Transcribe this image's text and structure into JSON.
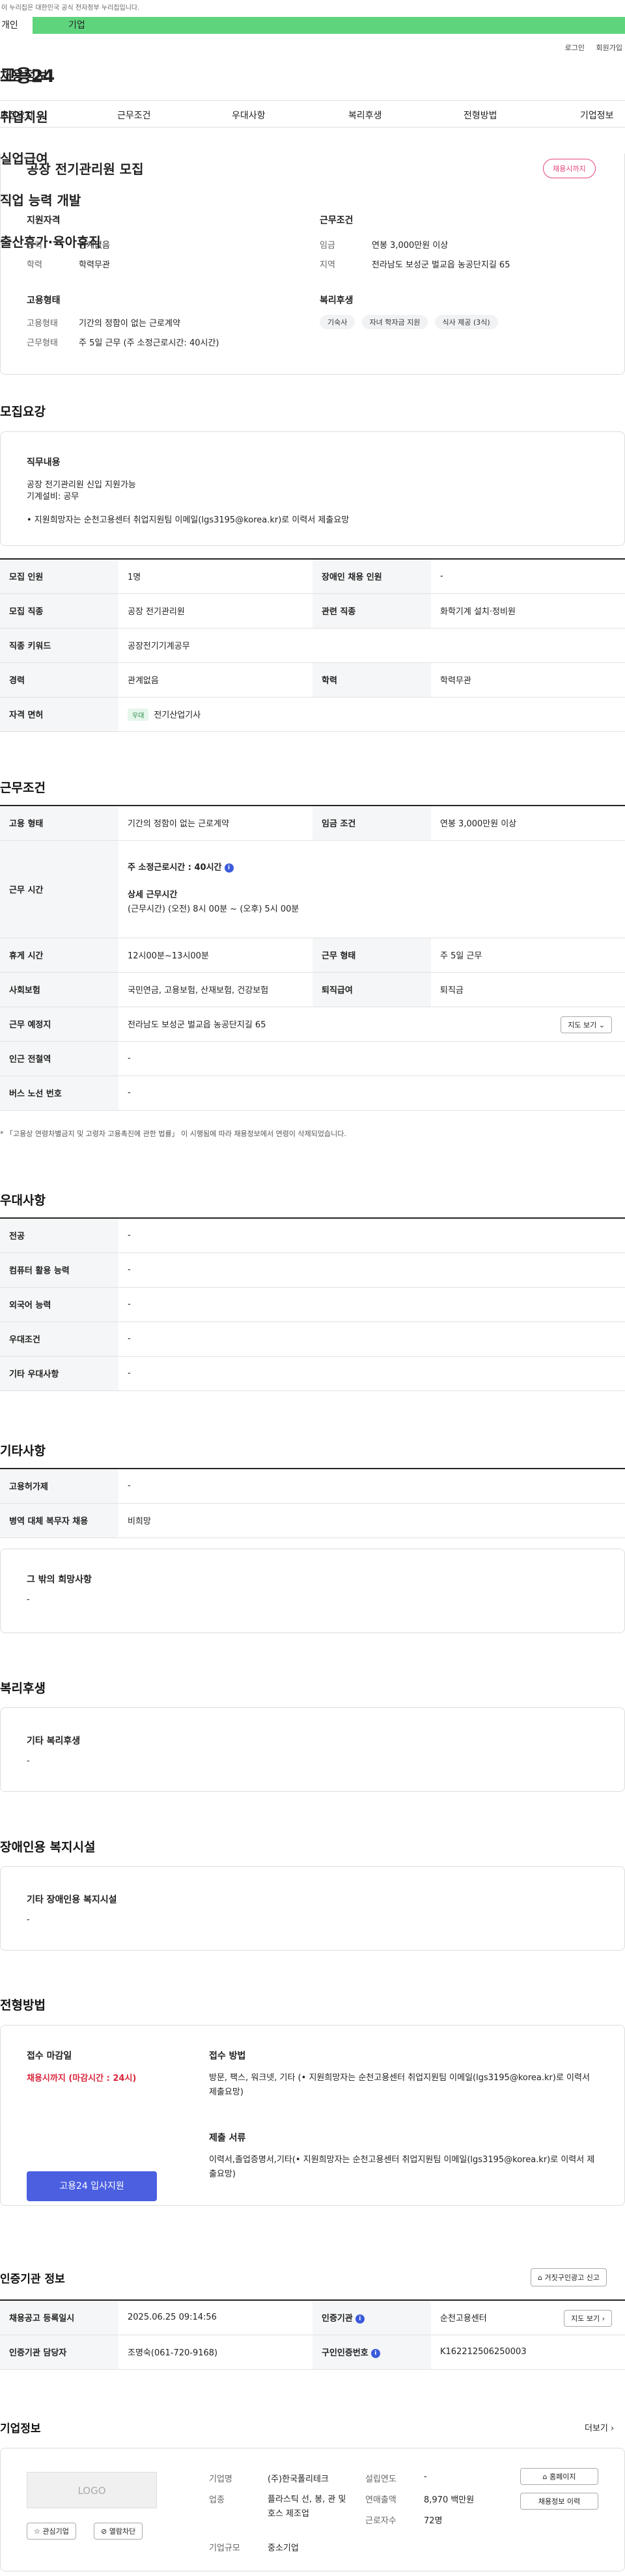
{
  "gov_banner": "이 누리집은 대한민국 공식 전자정부 누리집입니다.",
  "top_tabs": {
    "personal": "개인",
    "company": "기업"
  },
  "util": {
    "login": "로그인",
    "join": "회원가입"
  },
  "logo": "고용24",
  "gnb": [
    "채용정보",
    "취업지원",
    "실업급여",
    "직업 능력 개발",
    "출산휴가·육아휴직"
  ],
  "subnav": [
    "모집요강",
    "근무조건",
    "우대사항",
    "복리후생",
    "전형방법",
    "기업정보"
  ],
  "summary": {
    "title": "공장 전기관리원 모집",
    "badge": "채용시까지",
    "qual_heading": "지원자격",
    "career_label": "경력",
    "career_value": "관계없음",
    "edu_label": "학력",
    "edu_value": "학력무관",
    "emp_heading": "고용형태",
    "emp_type_label": "고용형태",
    "emp_type_value": "기간의 정함이 없는 근로계약",
    "work_type_label": "근무형태",
    "work_type_value": "주 5일 근무 (주 소정근로시간: 40시간)",
    "cond_heading": "근무조건",
    "wage_label": "임금",
    "wage_value": "연봉 3,000만원 이상",
    "region_label": "지역",
    "region_value": "전라남도 보성군 벌교읍 농공단지길 65",
    "welfare_heading": "복리후생",
    "welfare_chips": [
      "기숙사",
      "자녀 학자금 지원",
      "식사 제공 (3식)"
    ]
  },
  "recruit": {
    "heading": "모집요강",
    "duty_label": "직무내용",
    "duty_lines": [
      "공장 전기관리원 신입 지원가능",
      "기계설비: 공무"
    ],
    "duty_note": "• 지원희망자는 순천고용센터 취업지원팀 이메일(lgs3195@korea.kr)로 이력서 제출요망",
    "rows": {
      "headcount_label": "모집 인원",
      "headcount_value": "1명",
      "disabled_label": "장애인 채용 인원",
      "disabled_value": "-",
      "job_label": "모집 직종",
      "job_value": "공장 전기관리원",
      "related_label": "관련 직종",
      "related_value": "화학기계 설치·정비원",
      "keyword_label": "직종 키워드",
      "keyword_value": "공장전기기계공무",
      "career_label": "경력",
      "career_value": "관계없음",
      "edu_label": "학력",
      "edu_value": "학력무관",
      "license_label": "자격 면허",
      "license_tag": "우대",
      "license_value": "전기산업기사"
    }
  },
  "conditions": {
    "heading": "근무조건",
    "emp_label": "고용 형태",
    "emp_value": "기간의 정함이 없는 근로계약",
    "wage_label": "임금 조건",
    "wage_value": "연봉 3,000만원 이상",
    "time_label": "근무 시간",
    "time_weekly": "주 소정근로시간 : 40시간",
    "time_detail_title": "상세 근무시간",
    "time_detail": "(근무시간) (오전) 8시 00분 ~ (오후) 5시 00분",
    "break_label": "휴게 시간",
    "break_value": "12시00분~13시00분",
    "shape_label": "근무 형태",
    "shape_value": "주 5일 근무",
    "insurance_label": "사회보험",
    "insurance_value": "국민연금, 고용보험, 산재보험, 건강보험",
    "retire_label": "퇴직급여",
    "retire_value": "퇴직금",
    "place_label": "근무 예정지",
    "place_value": "전라남도 보성군 벌교읍 농공단지길 65",
    "map_btn": "지도 보기",
    "station_label": "인근 전철역",
    "station_value": "-",
    "bus_label": "버스 노선 번호",
    "bus_value": "-",
    "footnote": "* 「고용상 연령차별금지 및 고령자 고용촉진에 관한 법률」 이 시행됨에 따라 채용정보에서 연령이 삭제되었습니다."
  },
  "preference": {
    "heading": "우대사항",
    "rows": [
      {
        "label": "전공",
        "value": "-"
      },
      {
        "label": "컴퓨터 활용 능력",
        "value": "-"
      },
      {
        "label": "외국어 능력",
        "value": "-"
      },
      {
        "label": "우대조건",
        "value": "-"
      },
      {
        "label": "기타 우대사항",
        "value": "-"
      }
    ]
  },
  "etc": {
    "heading": "기타사항",
    "employ_label": "고용허가제",
    "employ_value": "-",
    "military_label": "병역 대체 복무자 채용",
    "military_value": "비희망",
    "other_label": "그 밖의 희망사항",
    "other_value": "-"
  },
  "welfare": {
    "heading": "복리후생",
    "label": "기타 복리후생",
    "value": "-"
  },
  "disabled": {
    "heading": "장애인용 복지시설",
    "label": "기타 장애인용 복지시설",
    "value": "-"
  },
  "selection": {
    "heading": "전형방법",
    "deadline_label": "접수 마감일",
    "deadline_value": "채용시까지 (마감시간 : 24시)",
    "apply_btn": "고용24 입사지원",
    "method_label": "접수 방법",
    "method_value": "방문, 팩스, 워크넷, 기타 (• 지원희망자는 순천고용센터 취업지원팀 이메일(lgs3195@korea.kr)로 이력서 제출요망)",
    "docs_label": "제출 서류",
    "docs_value": "이력서,졸업증명서,기타(• 지원희망자는 순천고용센터 취업지원팀 이메일(lgs3195@korea.kr)로 이력서 제출요망)"
  },
  "agency": {
    "heading": "인증기관 정보",
    "report_btn": "거짓구인광고 신고",
    "reg_label": "채용공고 등록일시",
    "reg_value": "2025.06.25 09:14:56",
    "org_label": "인증기관",
    "org_value": "순천고용센터",
    "map_btn": "지도 보기",
    "staff_label": "인증기관 담당자",
    "staff_value": "조명숙(061-720-9168)",
    "cert_label": "구인인증번호",
    "cert_value": "K162212506250003"
  },
  "company": {
    "heading": "기업정보",
    "more": "더보기",
    "logo_text": "LOGO",
    "fav_btn": "관심기업",
    "block_btn": "열람차단",
    "name_label": "기업명",
    "name_value": "(주)한국폴리테크",
    "industry_label": "업종",
    "industry_value": "플라스틱 선, 봉, 관 및 호스 제조업",
    "size_label": "기업규모",
    "size_value": "중소기업",
    "year_label": "설립연도",
    "year_value": "-",
    "sales_label": "연매출액",
    "sales_value": "8,970 백만원",
    "staff_label": "근로자수",
    "staff_value": "72명",
    "home_btn": "홈페이지",
    "history_btn": "채용정보 이력"
  }
}
